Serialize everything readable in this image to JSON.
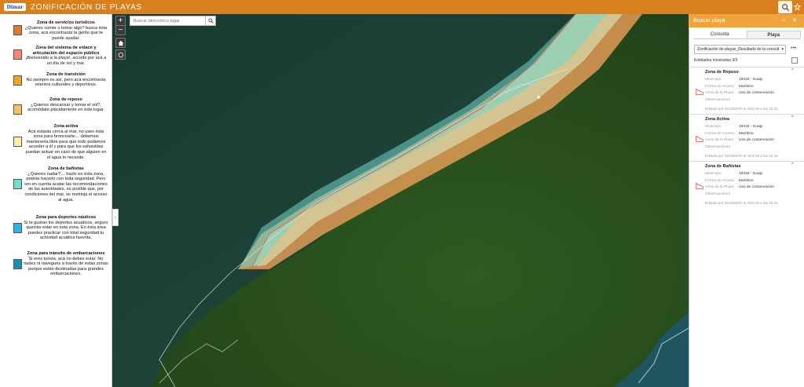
{
  "header": {
    "logo_text": "Dimar",
    "title": "ZONIFICACIÓN DE PLAYAS",
    "search_icon": "search-icon",
    "layers_icon": "layers-icon"
  },
  "legend": {
    "items": [
      {
        "title": "Zona de servicios turísticos",
        "desc": "¿Quieres comer o tomar algo? busca ésta zona, acá encontrarás la gente que te puede ayudar.",
        "color": "#e07a2e"
      },
      {
        "title": "Zona del sistema de enlace y articulación del espacio público",
        "desc": "¡Bienvenido a la playa!, accede por acá a un día de sol y mar.",
        "color": "#ef8a7a"
      },
      {
        "title": "Zona de transición",
        "desc": "No siempre es así, pero acá encontrarás eventos culturales y deportivos.",
        "color": "#f4a623"
      },
      {
        "title": "Zona de reposo",
        "desc": "¿Quieres descansar y tomar el sol?, acomódate plácidamente en éste lugar.",
        "color": "#f3c06a"
      },
      {
        "title": "Zona activa",
        "desc": "Acá estarás cerca al mar, no uses ésta zona para broncearte… debemos mantenerla libre para que todo podamos acceder a él y para que los salvavidas puedan actuar en caso de que alguien en el agua lo necesite.",
        "color": "#fbf2a8"
      },
      {
        "title": "Zona de bañistas",
        "desc": "¿Quieres nadar?… hazlo en ésta zona, podrás hacerlo con toda seguridad. Pero ten en cuenta acatar las recomendaciones de las autoridades, es posible que, por condiciones del mar, se restrinja el acceso al agua.",
        "color": "#6fe0d0"
      },
      {
        "title": "Zona para deportes náuticos",
        "desc": "Si te gustan los deportes acuáticos, seguro querrás estar en esta zona. En ésta área puedes practicar con total seguridad tu actividad acuática favorita.",
        "color": "#2fb4e6"
      },
      {
        "title": "Zona para tránsito de embarcaciones",
        "desc": "Si eres turista, acá no debes estar. No nades ni navegues a través de estas zonas porque están destinadas para grandes embarcaciones.",
        "color": "#1a8fb3"
      }
    ]
  },
  "map": {
    "search_placeholder": "Buscar dirección o lugar",
    "zoom_in": "+",
    "zoom_out": "−",
    "collapse": "‹"
  },
  "panel": {
    "title": "Buscar playa",
    "tabs": [
      "Consulta",
      "Playa"
    ],
    "active_tab": "Playa",
    "layer_select": "Zonificación de playas_Resultado de la consult",
    "more": "•••",
    "count": "Entidades mostradas 3/3",
    "field_labels": [
      "Municipio",
      "Forma de Acceso",
      "Usos de la Playa",
      "Observaciones"
    ],
    "cards": [
      {
        "title": "Zona de Reposo",
        "municipio": "19318 - Guapi",
        "acceso": "Marítimo",
        "usos": "Uso de conservación",
        "observaciones": "",
        "edited": "Editado por SIGDIMAR el 15/4/19 a las 16:41"
      },
      {
        "title": "Zona Activa",
        "municipio": "19318 - Guapi",
        "acceso": "Marítimo",
        "usos": "Uso de conservación",
        "observaciones": "",
        "edited": "Editado por SIGDIMAR el 15/4/19 a las 16:41"
      },
      {
        "title": "Zona de Bañistas",
        "municipio": "19318 - Guapi",
        "acceso": "Marítimo",
        "usos": "Uso de conservación",
        "observaciones": "",
        "edited": "Editado por SIGDIMAR el 15/4/19 a las 16:41"
      }
    ]
  }
}
